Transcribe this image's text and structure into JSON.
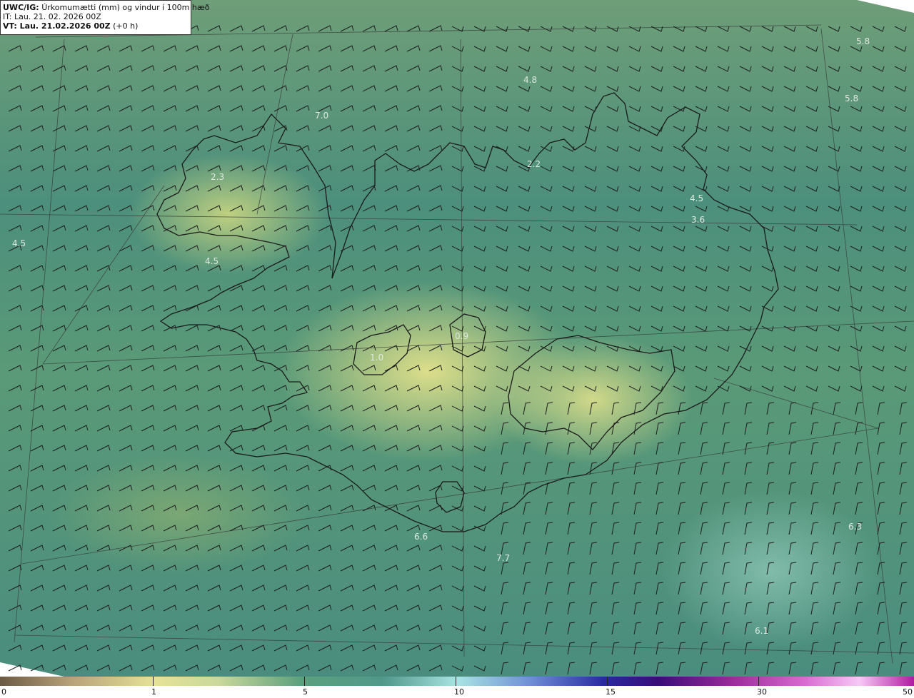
{
  "header": {
    "model": "UWC/IG:",
    "title": "Úrkomumætti (mm) og vindur í 100m hæð",
    "init_time": "IT: Lau. 21. 02. 2026 00Z",
    "valid_prefix": "VT: Lau. 21.02.2026 00Z",
    "valid_suffix": "(+0 h)"
  },
  "colorbar": {
    "ticks": [
      "0",
      "1",
      "5",
      "10",
      "15",
      "30",
      "50"
    ]
  },
  "point_labels": [
    {
      "id": "pl-1",
      "value": "5.8"
    },
    {
      "id": "pl-2",
      "value": "4.8"
    },
    {
      "id": "pl-3",
      "value": "5.8"
    },
    {
      "id": "pl-4",
      "value": "7.0"
    },
    {
      "id": "pl-5",
      "value": "2.2"
    },
    {
      "id": "pl-6",
      "value": "2.3"
    },
    {
      "id": "pl-7",
      "value": "4.5"
    },
    {
      "id": "pl-8",
      "value": "4.5"
    },
    {
      "id": "pl-9",
      "value": "3.6"
    },
    {
      "id": "pl-10",
      "value": "0.9"
    },
    {
      "id": "pl-11",
      "value": "1.0"
    },
    {
      "id": "pl-12",
      "value": "6.6"
    },
    {
      "id": "pl-13",
      "value": "7.7"
    },
    {
      "id": "pl-14",
      "value": "6.3"
    },
    {
      "id": "pl-15",
      "value": "6.1"
    },
    {
      "id": "pl-16",
      "value": "4.5"
    }
  ],
  "colors": {
    "coast": "#1a1a1a",
    "grid": "#3a3a3a",
    "barb": "#1f1f1f",
    "label": "#dfe8e0"
  }
}
